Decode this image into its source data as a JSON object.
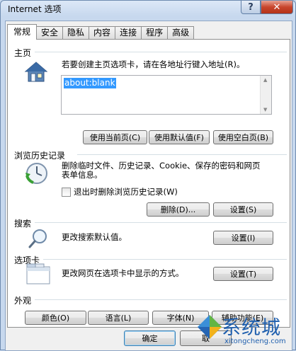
{
  "window": {
    "title": "Internet 选项",
    "help_label": "?",
    "close_label": "✕"
  },
  "tabs": [
    {
      "label": "常规",
      "active": true
    },
    {
      "label": "安全"
    },
    {
      "label": "隐私"
    },
    {
      "label": "内容"
    },
    {
      "label": "连接"
    },
    {
      "label": "程序"
    },
    {
      "label": "高级"
    }
  ],
  "homepage": {
    "title": "主页",
    "description": "若要创建主页选项卡，请在各地址行键入地址(R)。",
    "address_value": "about:blank",
    "use_current_label": "使用当前页(C)",
    "use_default_label": "使用默认值(F)",
    "use_blank_label": "使用空白页(B)"
  },
  "history": {
    "title": "浏览历史记录",
    "description_line1": "删除临时文件、历史记录、Cookie、保存的密码和网页",
    "description_line2": "表单信息。",
    "checkbox_label": "退出时删除浏览历史记录(W)",
    "checkbox_checked": false,
    "delete_label": "删除(D)...",
    "settings_label": "设置(S)"
  },
  "search": {
    "title": "搜索",
    "description": "更改搜索默认值。",
    "settings_label": "设置(I)"
  },
  "tabs_section": {
    "title": "选项卡",
    "description": "更改网页在选项卡中显示的方式。",
    "settings_label": "设置(T)"
  },
  "appearance": {
    "title": "外观",
    "colors_label": "颜色(O)",
    "languages_label": "语言(L)",
    "fonts_label": "字体(N)",
    "accessibility_label": "辅助功能(E)"
  },
  "footer": {
    "ok_label": "确定",
    "cancel_label": "取"
  },
  "watermark": {
    "name": "系统城",
    "url": "xitongcheng.com"
  }
}
